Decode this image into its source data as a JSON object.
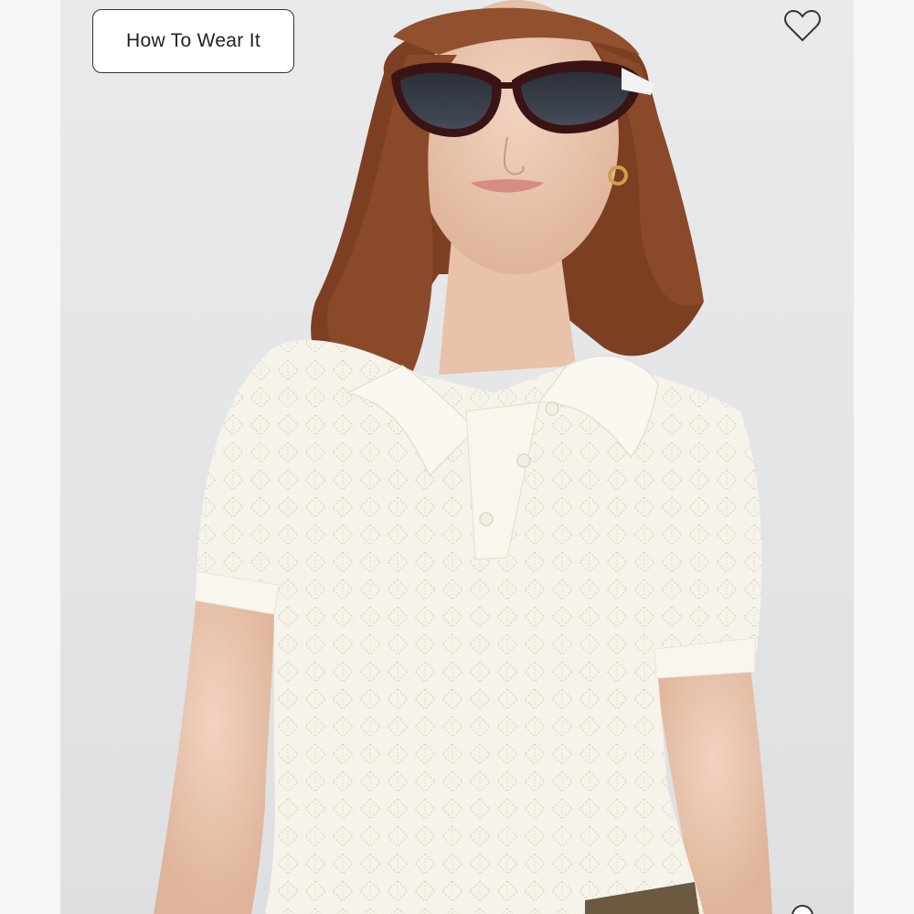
{
  "product_gallery": {
    "how_to_wear_label": "How To Wear It",
    "favorite_icon": "heart-icon",
    "zoom_icon": "magnifier-icon",
    "colors": {
      "button_border": "#333333",
      "button_text": "#222222",
      "background": "#e6e7e9",
      "garment": "#f6f3ea",
      "hair": "#8a4a2a"
    }
  }
}
